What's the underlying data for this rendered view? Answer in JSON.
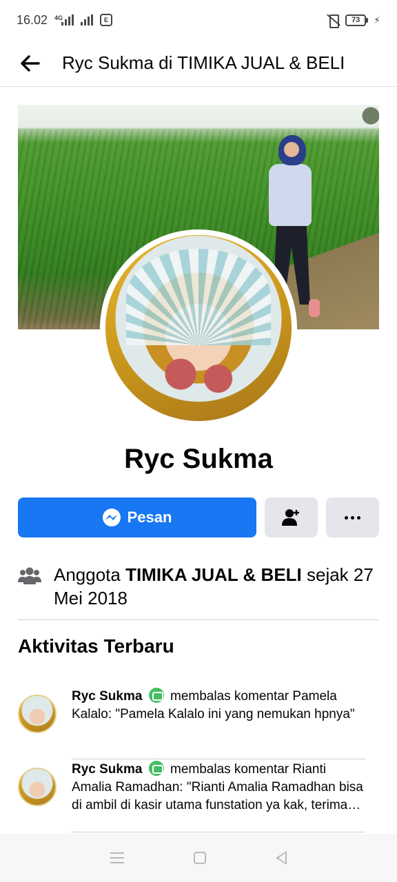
{
  "status_bar": {
    "time": "16.02",
    "network": "4G",
    "app_badge": "E",
    "battery": "73"
  },
  "header": {
    "title": "Ryc Sukma di TIMIKA JUAL & BELI"
  },
  "profile": {
    "name": "Ryc Sukma"
  },
  "actions": {
    "message_label": "Pesan"
  },
  "membership": {
    "prefix": "Anggota ",
    "group": "TIMIKA JUAL & BELI",
    "suffix": " sejak 27 Mei 2018"
  },
  "activity": {
    "title": "Aktivitas Terbaru",
    "items": [
      {
        "name": "Ryc Sukma",
        "text": " membalas komentar Pamela Kalalo: \"Pamela Kalalo ini yang nemukan hpnya\""
      },
      {
        "name": "Ryc Sukma",
        "text": " membalas komentar Rianti Amalia Ramadhan: \"Rianti Amalia Ramadhan bisa di ambil di kasir utama funstation ya kak, terima kasih\""
      }
    ]
  },
  "icons": {
    "back": "arrow-left-icon",
    "messenger": "messenger-icon",
    "add_friend": "add-friend-icon",
    "more": "more-icon",
    "members": "members-icon",
    "comment": "comment-icon"
  },
  "colors": {
    "primary": "#1877f2",
    "secondary_button": "#e4e6eb",
    "comment_badge": "#45bd62"
  }
}
